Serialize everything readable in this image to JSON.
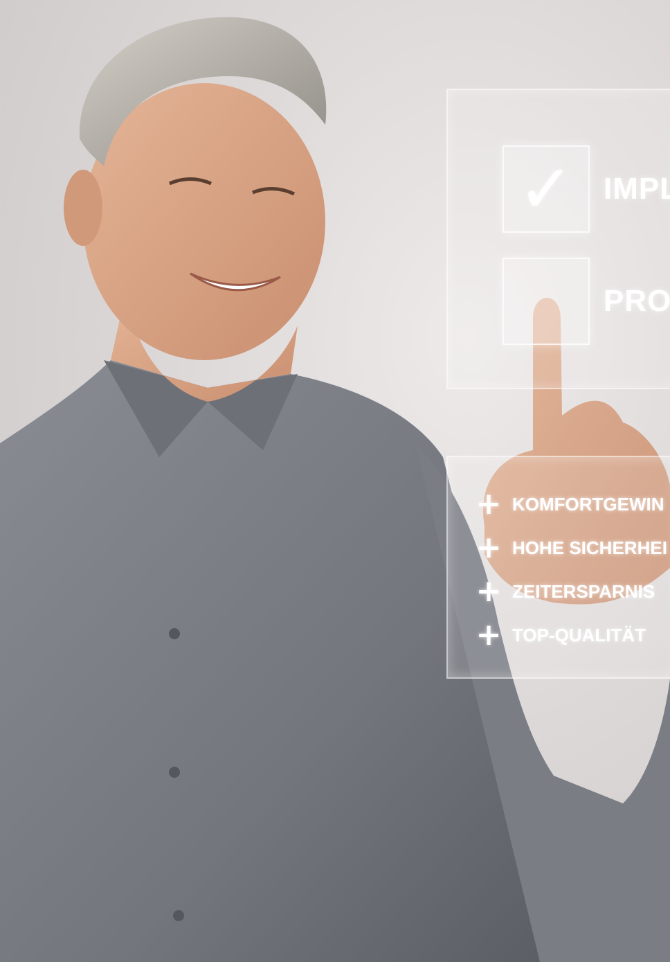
{
  "options": [
    {
      "label": "IMPL",
      "checked": true
    },
    {
      "label": "PROT",
      "checked": false
    }
  ],
  "benefits": [
    {
      "icon": "plus-icon",
      "text": "KOMFORTGEWIN"
    },
    {
      "icon": "plus-icon",
      "text": "HOHE SICHERHEI"
    },
    {
      "icon": "plus-icon",
      "text": "ZEITERSPARNIS"
    },
    {
      "icon": "plus-icon",
      "text": "TOP-QUALITÄT"
    }
  ],
  "icons": {
    "checkmark": "checkmark-icon",
    "plus": "plus-icon"
  },
  "colors": {
    "overlay_text": "#ffffff",
    "shirt": "#7a7c84",
    "background": "#ddd8d8"
  }
}
